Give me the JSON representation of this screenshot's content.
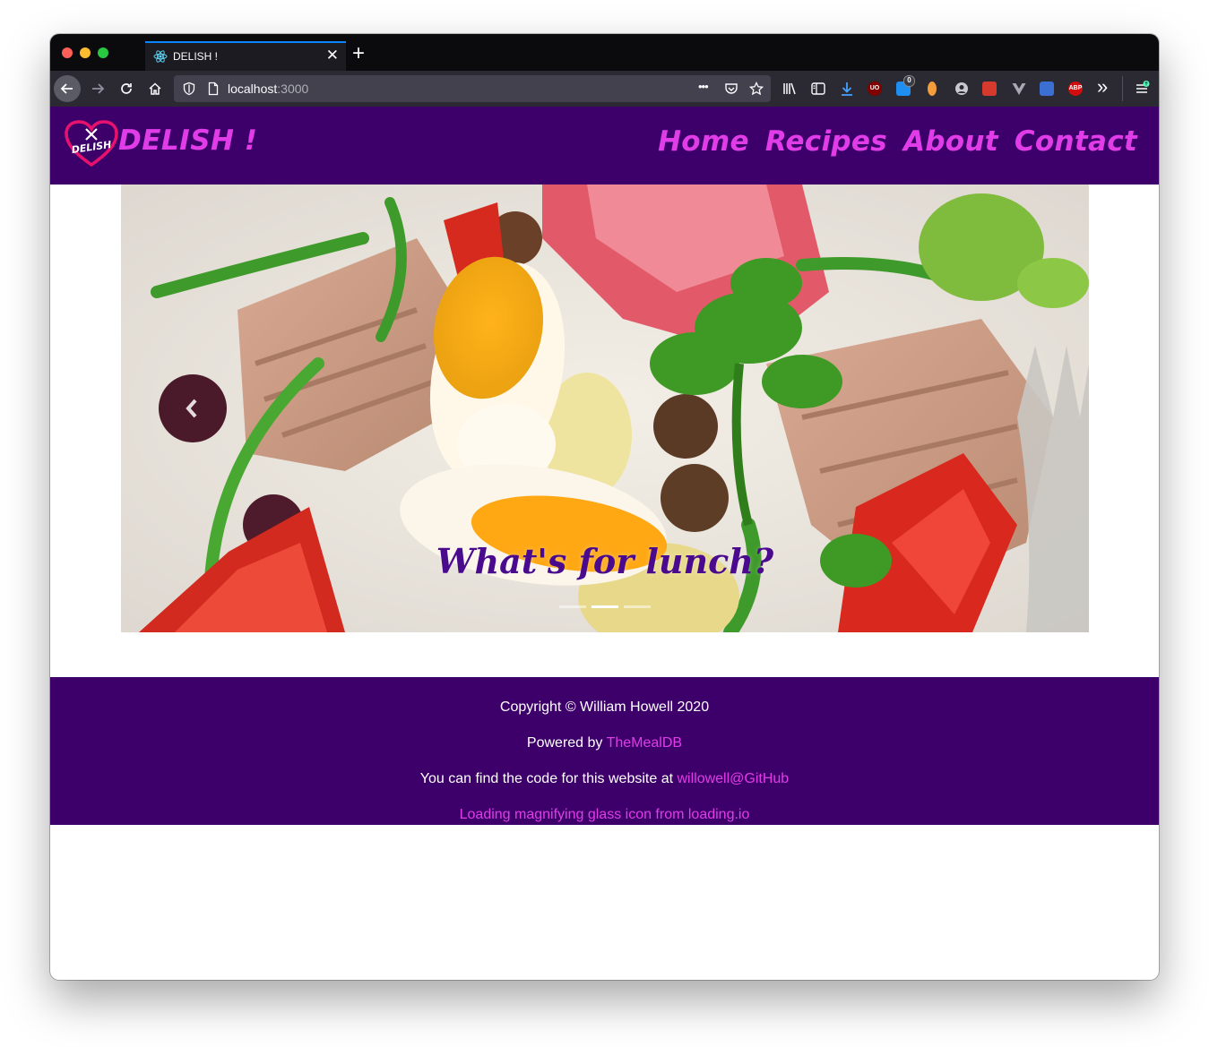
{
  "browser": {
    "tab_title": "DELISH !",
    "close_glyph": "✕",
    "new_tab_glyph": "+",
    "url_host": "localhost",
    "url_port": ":3000",
    "overflow_menu_glyph": "•••",
    "ublock_badge": "UO",
    "extension_badge_count": "0",
    "abp_label": "ABP",
    "more_tools_glyph": "»"
  },
  "site": {
    "brand": "DELISH !",
    "logo_text": "DELISH",
    "nav": [
      "Home",
      "Recipes",
      "About",
      "Contact"
    ]
  },
  "carousel": {
    "caption": "What's for lunch?",
    "slide_count": 3,
    "active_slide": 2
  },
  "footer": {
    "copyright": "Copyright © William Howell 2020",
    "powered_prefix": "Powered by ",
    "powered_link": "TheMealDB",
    "code_prefix": "You can find the code for this website at ",
    "code_link": "willowell@GitHub",
    "loading_link": "Loading magnifying glass icon from loading.io"
  },
  "colors": {
    "header_bg": "#3d006a",
    "accent_pink": "#e03ce8",
    "caption_purple": "#4a0a8e"
  }
}
